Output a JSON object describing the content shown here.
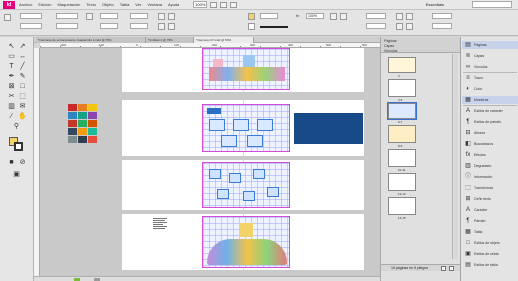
{
  "app": {
    "logo": "Id",
    "zoom": "100%",
    "workspace": "Essentials",
    "search_placeholder": ""
  },
  "menu": [
    "Archivo",
    "Edición",
    "Maquetación",
    "Texto",
    "Objeto",
    "Tabla",
    "Ver",
    "Ventana",
    "Ayuda"
  ],
  "controlbar": {
    "x_field": "",
    "y_field": "",
    "w_field": "",
    "h_field": "",
    "stroke_weight": "",
    "opacity": "100%",
    "fx_label": "fx"
  },
  "tabs": [
    {
      "label": "*Interiores de entrenamiento Cuadernillo 1.indd @ 75%",
      "active": false
    },
    {
      "label": "*Untitled-1 @ 75%",
      "active": false
    },
    {
      "label": "*Interiores 07.indd @ 50%",
      "active": true
    }
  ],
  "ruler": [
    "-200",
    "-100",
    "0",
    "100",
    "200",
    "300",
    "400",
    "500",
    "600"
  ],
  "tools": [
    "selection-icon",
    "direct-selection-icon",
    "page-tool-icon",
    "gap-tool-icon",
    "type-icon",
    "line-icon",
    "pen-icon",
    "pencil-icon",
    "rectangle-frame-icon",
    "rectangle-icon",
    "scissors-icon",
    "free-transform-icon",
    "gradient-icon",
    "note-icon",
    "eyedropper-icon",
    "hand-icon",
    "zoom-icon"
  ],
  "colors": {
    "accent": "#e3007d",
    "selection": "#3a6fd8",
    "guide": "#d44bd4",
    "blue_block": "#184a8a"
  },
  "swatches": [
    "#c92a2a",
    "#e67e22",
    "#f1c40f",
    "#2e86c1",
    "#16a085",
    "#8e44ad",
    "#c0392b",
    "#27ae60",
    "#d35400",
    "#34495e",
    "#f39c12",
    "#1abc9c",
    "#7f8c8d",
    "#2c3e50",
    "#e74c3c"
  ],
  "pages_panel": {
    "tabs": [
      "Páginas",
      "Capas",
      "Vínculos"
    ],
    "thumbs": [
      {
        "label": "3",
        "selected": false
      },
      {
        "label": "4-5",
        "selected": false
      },
      {
        "label": "6-7",
        "selected": true
      },
      {
        "label": "8-9",
        "selected": false
      },
      {
        "label": "10-11",
        "selected": false
      },
      {
        "label": "12-13",
        "selected": false
      },
      {
        "label": "14-15",
        "selected": false
      }
    ],
    "footer": "16 páginas en 9 pliegos"
  },
  "right_panels": [
    {
      "icon": "pages-icon",
      "glyph": "▤",
      "label": "Páginas",
      "highlight": true
    },
    {
      "icon": "layers-icon",
      "glyph": "≋",
      "label": "Capas"
    },
    {
      "icon": "links-icon",
      "glyph": "∞",
      "label": "Vínculos"
    },
    {
      "icon": "stroke-icon",
      "glyph": "≡",
      "label": "Trazo"
    },
    {
      "icon": "color-icon",
      "glyph": "◐",
      "label": "Color"
    },
    {
      "icon": "swatches-icon",
      "glyph": "▦",
      "label": "Muestras",
      "highlight": true
    },
    {
      "icon": "char-style-icon",
      "glyph": "A",
      "label": "Estilos de carácter"
    },
    {
      "icon": "para-style-icon",
      "glyph": "¶",
      "label": "Estilos de párrafo"
    },
    {
      "icon": "align-icon",
      "glyph": "⊟",
      "label": "Alinear"
    },
    {
      "icon": "pathfinder-icon",
      "glyph": "◧",
      "label": "Buscatrazos"
    },
    {
      "icon": "effects-icon",
      "glyph": "fx",
      "label": "Efectos"
    },
    {
      "icon": "gradient-icon",
      "glyph": "▥",
      "label": "Degradado"
    },
    {
      "icon": "info-icon",
      "glyph": "ⓘ",
      "label": "Información"
    },
    {
      "icon": "transform-icon",
      "glyph": "⬚",
      "label": "Transformar"
    },
    {
      "icon": "text-wrap-icon",
      "glyph": "⊞",
      "label": "Ceñir texto"
    },
    {
      "icon": "character-icon",
      "glyph": "A",
      "label": "Carácter"
    },
    {
      "icon": "paragraph-icon",
      "glyph": "¶",
      "label": "Párrafo"
    },
    {
      "icon": "table-icon",
      "glyph": "▦",
      "label": "Tabla"
    },
    {
      "icon": "object-styles-icon",
      "glyph": "□",
      "label": "Estilos de objeto"
    },
    {
      "icon": "cell-styles-icon",
      "glyph": "▣",
      "label": "Estilos de celda"
    },
    {
      "icon": "table-styles-icon",
      "glyph": "▤",
      "label": "Estilos de tabla"
    }
  ]
}
